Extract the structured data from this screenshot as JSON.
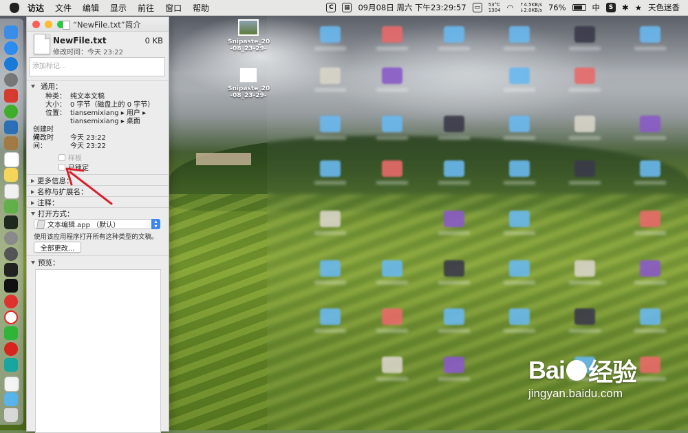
{
  "menubar": {
    "app_name": "访达",
    "menus": [
      "文件",
      "编辑",
      "显示",
      "前往",
      "窗口",
      "帮助"
    ],
    "status": {
      "temp": "53°C",
      "net_up": "↑4.5KB/s",
      "cpu": "1304",
      "net_down": "↓2.0KB/s",
      "datetime": "09月08日 周六 下午23:29:57",
      "battery": "76%",
      "input_method": "中",
      "user": "天色迷香"
    }
  },
  "window": {
    "title": "“NewFile.txt”简介",
    "file_name": "NewFile.txt",
    "file_size": "0 KB",
    "modified_line": "修改时间：今天 23:22",
    "tag_placeholder": "添加标记...",
    "general": {
      "heading": "通用：",
      "kind_label": "种类：",
      "kind_value": "纯文本文稿",
      "size_label": "大小：",
      "size_value": "0 字节（磁盘上的 0 字节）",
      "where_label": "位置：",
      "where_value1": "tiansemixiang ▸ 用户 ▸",
      "where_value2": "tiansemixiang ▸ 桌面",
      "created_label": "创建时间：",
      "created_value": "今天 23:22",
      "modified_label": "修改时间：",
      "modified_value": "今天 23:22",
      "stationery_label": "样板",
      "locked_label": "已锁定"
    },
    "sections": {
      "more_info": "更多信息：",
      "name_ext": "名称与扩展名：",
      "comments": "注释：",
      "open_with": "打开方式：",
      "preview": "预览："
    },
    "open_with": {
      "app": "文本编辑.app （默认）",
      "hint": "使用该应用程序打开所有这种类型的文稿。",
      "change_all": "全部更改..."
    }
  },
  "desktop": {
    "files": [
      {
        "name_line1": "Snipaste_20",
        "name_line2": "-08_23-29-"
      },
      {
        "name_line1": "Snipaste_20",
        "name_line2": "-08_23-29-"
      }
    ]
  },
  "watermark": {
    "logo_text_a": "Bai",
    "logo_text_b": "经验",
    "url": "jingyan.baidu.com"
  }
}
